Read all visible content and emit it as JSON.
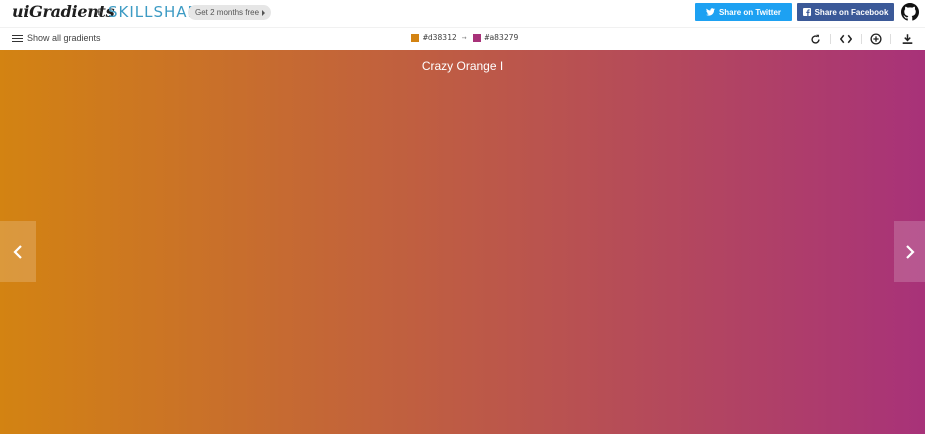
{
  "header": {
    "logo_text": "uiGradients",
    "plus": "+",
    "partner": "SKILLSHARE",
    "promo_label": "Get 2 months free",
    "twitter_label": "Share on Twitter",
    "facebook_label": "Share on Facebook",
    "github_icon": "github-icon"
  },
  "toolbar": {
    "menu_label": "Show all gradients",
    "color_from": "#d38312",
    "color_arrow": "→",
    "color_to": "#a83279",
    "tools": [
      "rotate-icon",
      "code-icon",
      "add-icon",
      "download-icon"
    ]
  },
  "gradient": {
    "name": "Crazy Orange I",
    "from": "#d38312",
    "to": "#a83279"
  },
  "colors": {
    "twitter": "#1da1f2",
    "facebook": "#3b5998",
    "skillshare": "#3d9bc4"
  }
}
